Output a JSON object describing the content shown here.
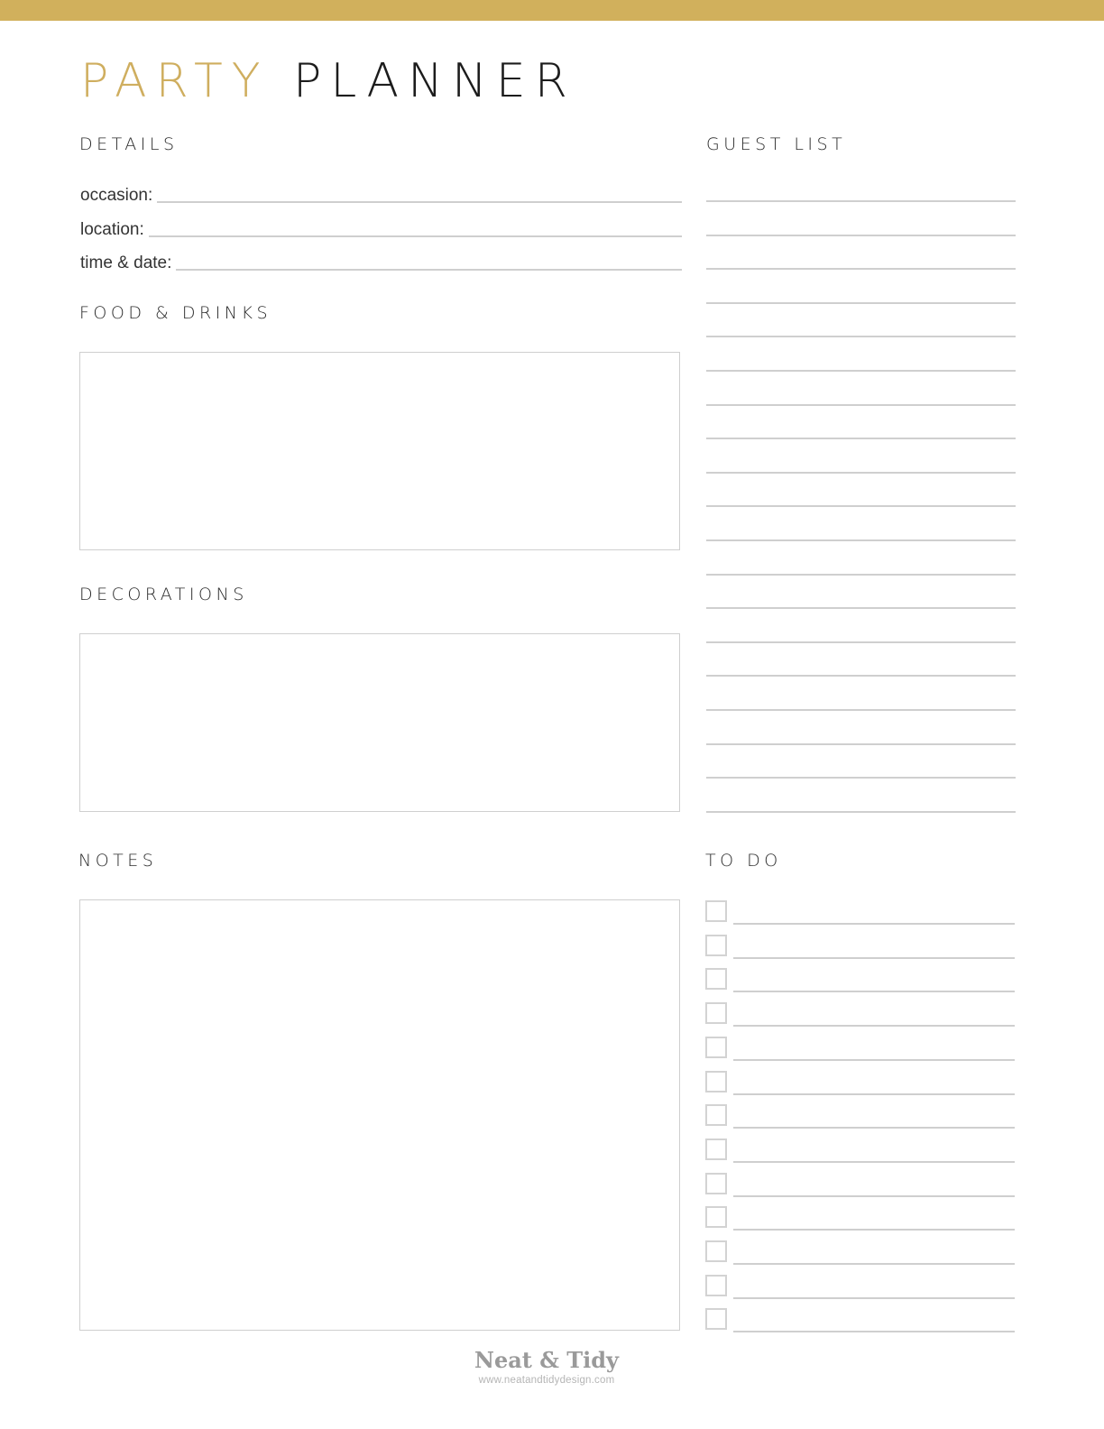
{
  "colors": {
    "accent_gold": "#d1b05c",
    "line_gray": "#cfcfcf",
    "text_dark": "#1c1c1c"
  },
  "title": {
    "part1": "PARTY",
    "part2": "PLANNER"
  },
  "details": {
    "heading": "DETAILS",
    "fields": [
      {
        "label": "occasion:",
        "value": ""
      },
      {
        "label": "location:",
        "value": ""
      },
      {
        "label": "time & date:",
        "value": ""
      }
    ]
  },
  "food_drinks": {
    "heading": "FOOD & DRINKS",
    "value": ""
  },
  "decorations": {
    "heading": "DECORATIONS",
    "value": ""
  },
  "notes": {
    "heading": "NOTES",
    "value": ""
  },
  "guest_list": {
    "heading": "GUEST LIST",
    "line_count": 19
  },
  "todo": {
    "heading": "TO DO",
    "item_count": 13
  },
  "footer": {
    "brand": "Neat & Tidy",
    "url": "www.neatandtidydesign.com"
  }
}
